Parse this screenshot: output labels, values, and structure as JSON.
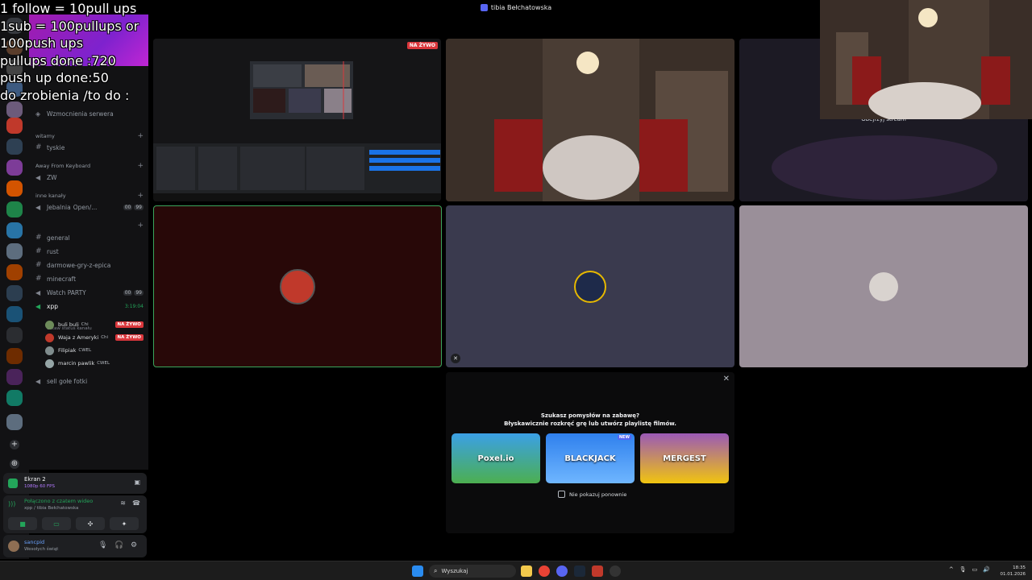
{
  "window": {
    "title": "tibia Bełchatowska"
  },
  "overlay": {
    "lines": [
      "1 follow = 10pull ups",
      "1sub = 100pullups or",
      "100push ups",
      "pullups done :720",
      "push up done:50",
      "do zrobienia /to do :"
    ]
  },
  "sidebar": {
    "boost": "Wzmocnienia serwera",
    "categories": {
      "witamy": "witamy",
      "away": "Away From Keyboard",
      "inne": "inne kanały"
    },
    "channels": {
      "tyskie": "tyskie",
      "zw": "ZW",
      "jebalnia": "Jebalnia",
      "jebalnia_suffix": "Open/...",
      "general": "general",
      "rust": "rust",
      "darmowe": "darmowe-gry-z-epica",
      "minecraft": "minecraft",
      "watch_party": "Watch PARTY",
      "xpp": "xpp",
      "xpp_timer": "3:19:04",
      "xpp_status": "Ustaw status kanału",
      "sell": "sell gołe fotki"
    },
    "counts": {
      "jebalnia": [
        "00",
        "99"
      ],
      "watch_party": [
        "00",
        "99"
      ]
    },
    "voice_users": [
      {
        "name": "buli buli",
        "tag": "Chi",
        "live": "NA ŻYWO",
        "color": "#6d8b5a"
      },
      {
        "name": "Waja z Ameryki",
        "tag": "Chi",
        "live": "NA ŻYWO",
        "color": "#c0392b"
      },
      {
        "name": "Filipiak",
        "tag": "CWEL",
        "live": "",
        "color": "#7f8c8d"
      },
      {
        "name": "marcin pawlik",
        "tag": "CWEL",
        "live": "",
        "color": "#95a5a6"
      }
    ]
  },
  "screen_share": {
    "title": "Ekran 2",
    "subtitle": "1080p 60 FPS"
  },
  "voice": {
    "status": "Połączono z czatem wideo",
    "location": "xpp / tibia Bełchatowska"
  },
  "current_user": {
    "name": "sancpid",
    "status": "Wesołych świąt"
  },
  "tiles": {
    "live_badge": "NA ŻYWO",
    "watch_stream": "Obejrzyj stream"
  },
  "activity": {
    "close": "✕",
    "title": "Szukasz pomysłów na zabawę?",
    "subtitle": "Błyskawicznie rozkręć grę lub utwórz playlistę filmów.",
    "cards": [
      {
        "label": "Poxel.io",
        "pill": ""
      },
      {
        "label": "BLACKJACK",
        "pill": "NEW"
      },
      {
        "label": "MERGEST",
        "pill": ""
      }
    ],
    "dont_show": "Nie pokazuj ponownie"
  },
  "taskbar": {
    "search_placeholder": "Wyszukaj",
    "time": "18:35",
    "date": "01.01.2026"
  },
  "colors": {
    "accent": "#5865f2",
    "live": "#da373c",
    "online": "#23a55a",
    "speaking_border": "#3ba55c"
  }
}
